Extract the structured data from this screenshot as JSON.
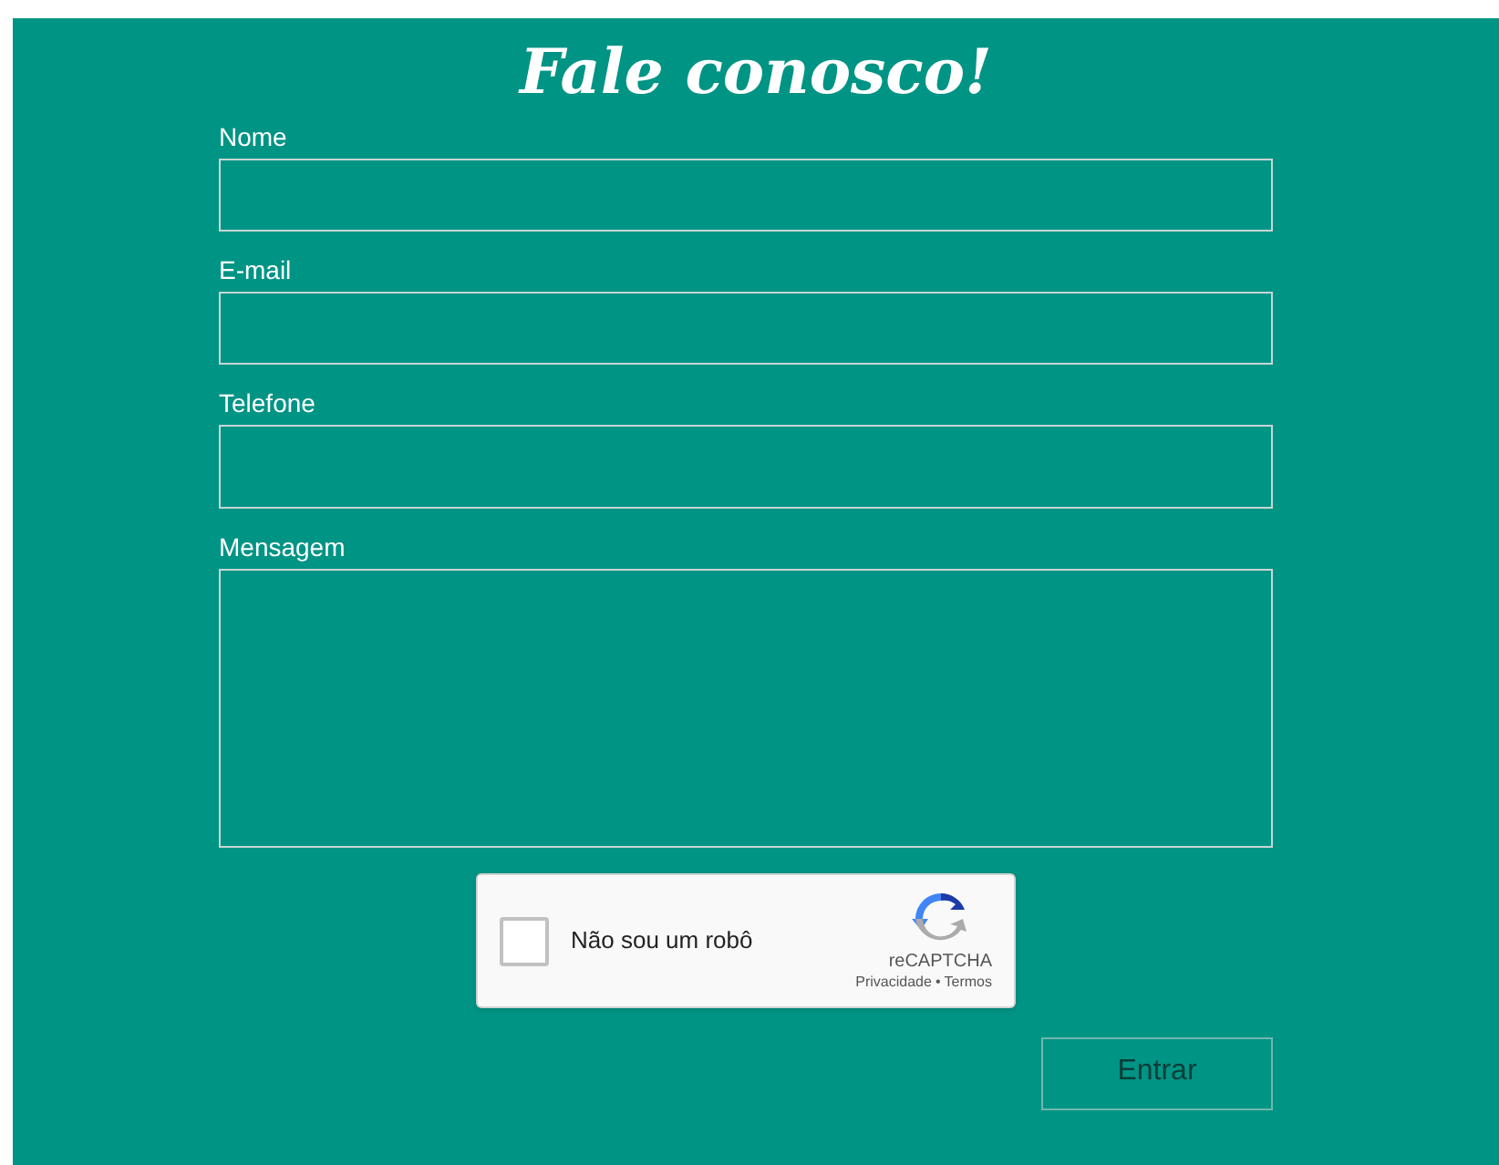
{
  "title": "Fale conosco!",
  "fields": [
    {
      "label": "Nome",
      "kind": "input"
    },
    {
      "label": "E-mail",
      "kind": "input"
    },
    {
      "label": "Telefone",
      "kind": "tall"
    },
    {
      "label": "Mensagem",
      "kind": "textarea"
    }
  ],
  "captcha": {
    "label": "Não sou um robô",
    "checked": false,
    "brand": "reCAPTCHA",
    "privacy": "Privacidade",
    "separator": "•",
    "terms": "Termos"
  },
  "submit": "Entrar"
}
